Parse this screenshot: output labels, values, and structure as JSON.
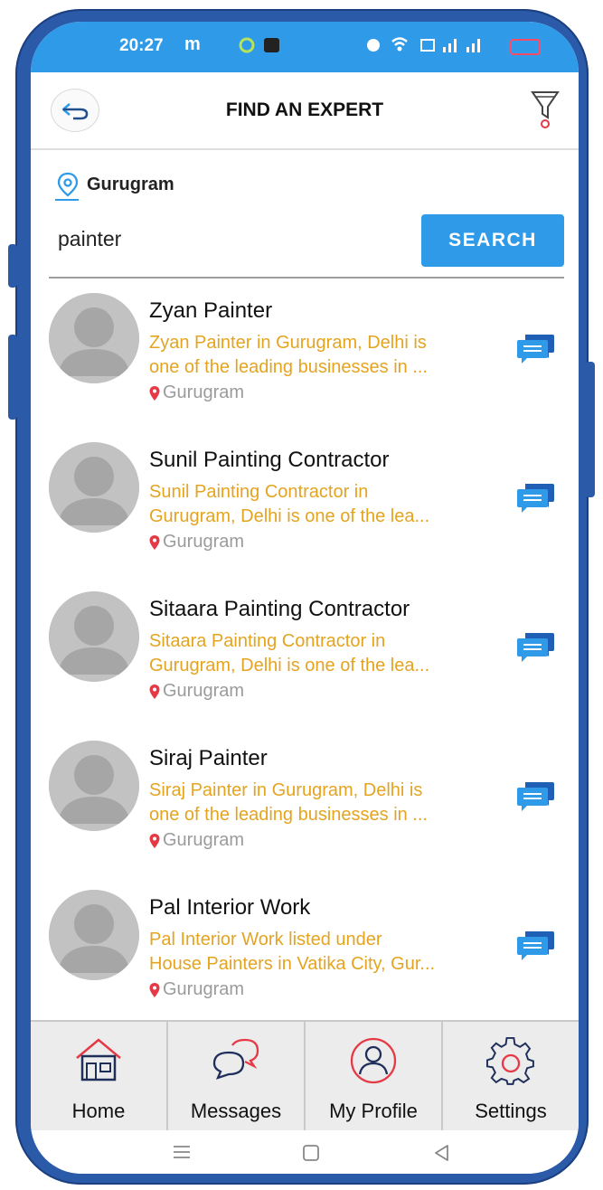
{
  "status_bar": {
    "time": "20:27",
    "carrier": "m",
    "signal_text": "ıl ıl"
  },
  "header": {
    "title": "FIND AN EXPERT",
    "back_icon": "back-arrow-icon",
    "filter_icon": "filter-icon"
  },
  "location": {
    "city": "Gurugram",
    "icon": "location-pin-icon"
  },
  "search": {
    "value": "painter",
    "button_label": "SEARCH"
  },
  "results": [
    {
      "name": "Zyan Painter",
      "desc_line1": "Zyan Painter in Gurugram, Delhi is",
      "desc_line2": "one of the leading businesses in ...",
      "city": "Gurugram"
    },
    {
      "name": "Sunil Painting Contractor",
      "desc_line1": "Sunil Painting Contractor in",
      "desc_line2": "Gurugram, Delhi is one of the lea...",
      "city": "Gurugram"
    },
    {
      "name": "Sitaara Painting Contractor",
      "desc_line1": "Sitaara Painting Contractor in",
      "desc_line2": "Gurugram, Delhi is one of the lea...",
      "city": "Gurugram"
    },
    {
      "name": "Siraj Painter",
      "desc_line1": "Siraj Painter in Gurugram, Delhi is",
      "desc_line2": "one of the leading businesses in ...",
      "city": "Gurugram"
    },
    {
      "name": "Pal Interior Work",
      "desc_line1": "Pal Interior Work listed under",
      "desc_line2": "House Painters in Vatika City, Gur...",
      "city": "Gurugram"
    }
  ],
  "bottom_nav": [
    {
      "label": "Home",
      "icon": "home-icon"
    },
    {
      "label": "Messages",
      "icon": "messages-icon"
    },
    {
      "label": "My Profile",
      "icon": "profile-icon"
    },
    {
      "label": "Settings",
      "icon": "settings-icon"
    }
  ],
  "colors": {
    "accent": "#2f9be8",
    "description": "#e4a420",
    "pin": "#e53946",
    "frame": "#2b5aa8"
  }
}
